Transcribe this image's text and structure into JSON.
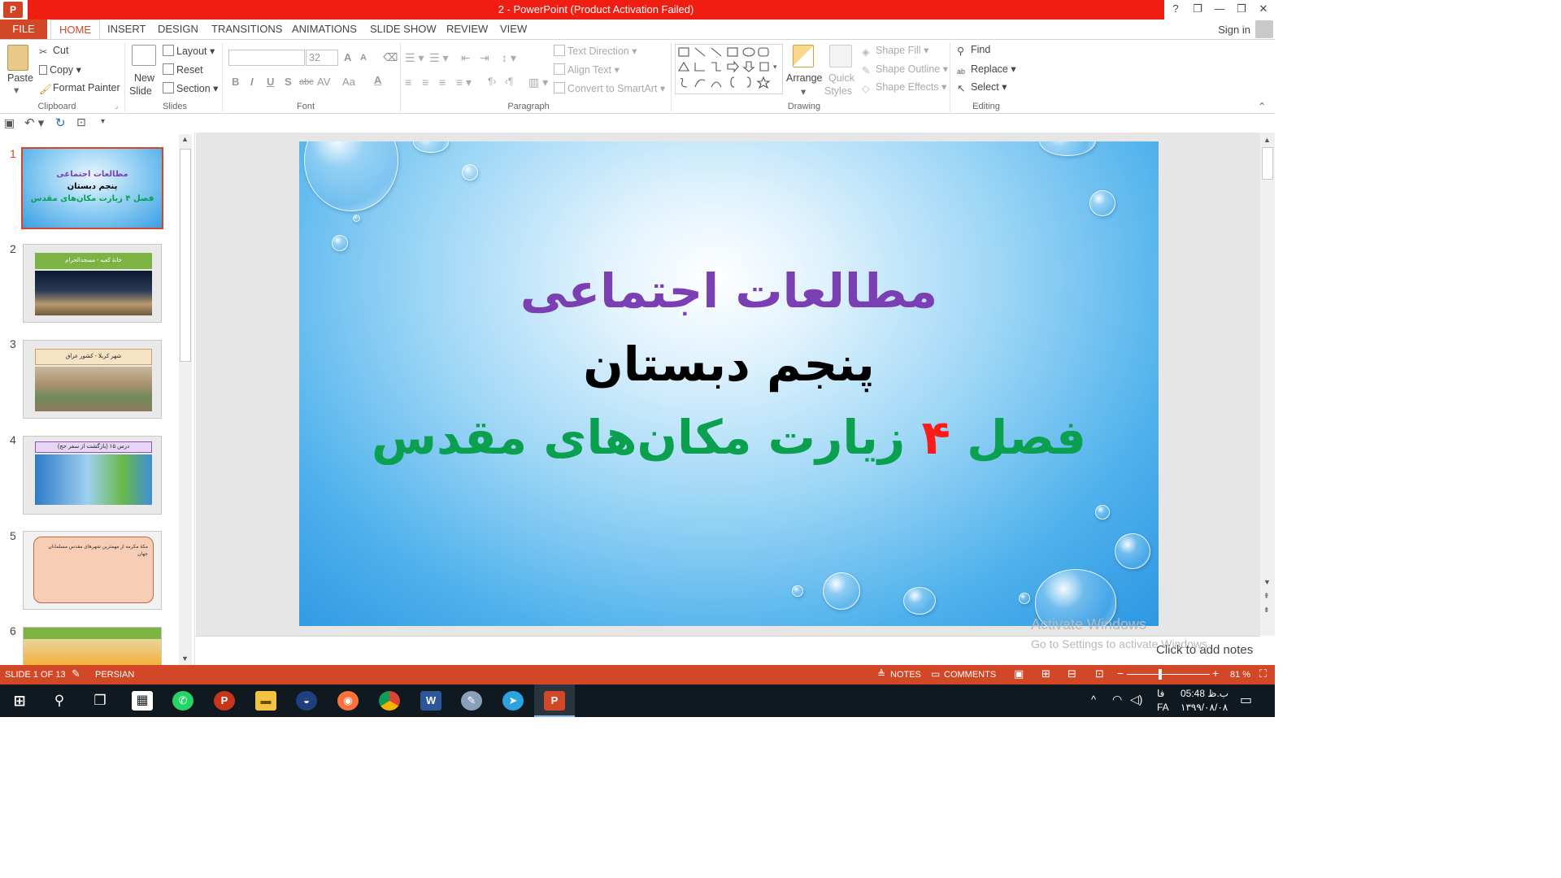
{
  "window": {
    "title": "2 - PowerPoint (Product Activation Failed)",
    "app_icon": "P",
    "controls": {
      "help": "?",
      "restore_ribbon": "❐",
      "minimize": "—",
      "maximize": "❒",
      "close": "✕"
    }
  },
  "tabs": [
    "FILE",
    "HOME",
    "INSERT",
    "DESIGN",
    "TRANSITIONS",
    "ANIMATIONS",
    "SLIDE SHOW",
    "REVIEW",
    "VIEW"
  ],
  "account": {
    "sign_in": "Sign in"
  },
  "ribbon": {
    "clipboard": {
      "paste": "Paste",
      "cut": "Cut",
      "copy": "Copy",
      "format_painter": "Format Painter",
      "label": "Clipboard"
    },
    "slides": {
      "new_slide": "New",
      "new_slide_2": "Slide",
      "layout": "Layout",
      "reset": "Reset",
      "section": "Section",
      "label": "Slides"
    },
    "font": {
      "font_size": "32",
      "bold": "B",
      "italic": "I",
      "underline": "U",
      "shadow": "S",
      "strike": "abc",
      "spacing": "AV",
      "case": "Aa",
      "color": "A",
      "grow": "A",
      "shrink": "A",
      "label": "Font"
    },
    "paragraph": {
      "text_direction": "Text Direction",
      "align_text": "Align Text",
      "convert_smartart": "Convert to SmartArt",
      "label": "Paragraph"
    },
    "drawing": {
      "arrange": "Arrange",
      "quick_styles": "Quick",
      "quick_styles_2": "Styles",
      "shape_fill": "Shape Fill",
      "shape_outline": "Shape Outline",
      "shape_effects": "Shape Effects",
      "label": "Drawing"
    },
    "editing": {
      "find": "Find",
      "replace": "Replace",
      "select": "Select",
      "label": "Editing"
    }
  },
  "thumbnails": [
    {
      "num": "1",
      "line1": "مطالعات اجتماعی",
      "line2": "پنجم دبستان",
      "line3": "فصل ۴ زیارت مکان‌های مقدس"
    },
    {
      "num": "2",
      "caption": "خانهٔ کعبه - مسجدالحرام"
    },
    {
      "num": "3",
      "caption": "شهر کربلا - کشور عراق"
    },
    {
      "num": "4",
      "caption": "درس ۱۵ (بازگشت از سفر حج)"
    },
    {
      "num": "5",
      "caption": "مکهٔ مکرمه از مهمترین شهرهای مقدس مسلمانان جهان"
    },
    {
      "num": "6",
      "caption": ""
    }
  ],
  "slide": {
    "line1": "مطالعات اجتماعی",
    "line2": "پنجم دبستان",
    "line3_a": "فصل ",
    "line3_num": "۴",
    "line3_b": " زیارت مکان‌های مقدس",
    "colors": {
      "line1": "#7b3fb4",
      "line2": "#000000",
      "line3": "#0aa04f",
      "num": "#ff1a1a"
    }
  },
  "notes": {
    "placeholder": "Click to add notes"
  },
  "activation": {
    "line1": "Activate Windows",
    "line2": "Go to Settings to activate Windows."
  },
  "status": {
    "slide": "SLIDE 1 OF 13",
    "language": "PERSIAN",
    "notes": "NOTES",
    "comments": "COMMENTS",
    "zoom": "81 %"
  },
  "taskbar": {
    "time": "ب.ظ 05:48",
    "date": "۱۳۹۹/۰۸/۰۸",
    "lang_top": "فا",
    "lang_bottom": "FA"
  },
  "theme": {
    "accent": "#d24726",
    "title_red": "#f01d12"
  }
}
